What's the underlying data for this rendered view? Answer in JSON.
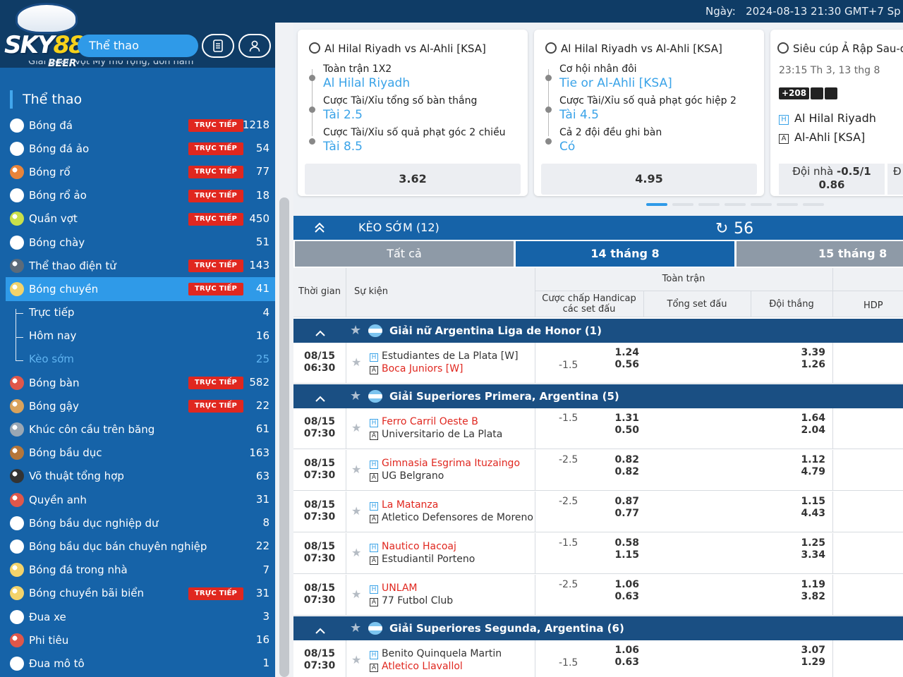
{
  "header": {
    "date_label": "Ngày:",
    "date_value": "2024-08-13 21:30 GMT+7 Sp",
    "brand_text": "SKY88",
    "brand_sub": "BEER",
    "sport_pill": "Thể thao",
    "peek_text": "Giải quần vợt Mỹ mở rộng, đơn nam"
  },
  "sidebar": {
    "section_title": "Thể thao",
    "live_label": "TRỰC TIẾP",
    "items": [
      {
        "label": "Bóng đá",
        "count": "1218",
        "live": true,
        "icon": "soccer-icon",
        "color": "#ffffff"
      },
      {
        "label": "Bóng đá ảo",
        "count": "54",
        "live": true,
        "icon": "virtual-soccer-icon",
        "color": "#ffffff"
      },
      {
        "label": "Bóng rổ",
        "count": "77",
        "live": true,
        "icon": "basketball-icon",
        "color": "#e8843a"
      },
      {
        "label": "Bóng rổ ảo",
        "count": "18",
        "live": true,
        "icon": "virtual-basketball-icon",
        "color": "#ffffff"
      },
      {
        "label": "Quần vợt",
        "count": "450",
        "live": true,
        "icon": "tennis-icon",
        "color": "#c9e04a"
      },
      {
        "label": "Bóng chày",
        "count": "51",
        "live": false,
        "icon": "baseball-icon",
        "color": "#ffffff"
      },
      {
        "label": "Thể thao điện tử",
        "count": "143",
        "live": true,
        "icon": "esports-icon",
        "color": "#5c6b7a"
      },
      {
        "label": "Bóng chuyền",
        "count": "41",
        "live": true,
        "icon": "volleyball-icon",
        "color": "#f3d36b",
        "active": true
      },
      {
        "label": "Trực tiếp",
        "count": "4",
        "live": false,
        "sub": true
      },
      {
        "label": "Hôm nay",
        "count": "16",
        "live": false,
        "sub": true
      },
      {
        "label": "Kèo sớm",
        "count": "25",
        "live": false,
        "sub": true,
        "muted": true
      },
      {
        "label": "Bóng bàn",
        "count": "582",
        "live": true,
        "icon": "table-tennis-icon",
        "color": "#e0574a"
      },
      {
        "label": "Bóng gậy",
        "count": "22",
        "live": true,
        "icon": "cricket-icon",
        "color": "#d9a25b"
      },
      {
        "label": "Khúc côn cầu trên băng",
        "count": "61",
        "live": false,
        "icon": "ice-hockey-icon",
        "color": "#9aa7b4"
      },
      {
        "label": "Bóng bầu dục",
        "count": "163",
        "live": false,
        "icon": "rugby-icon",
        "color": "#b5763a"
      },
      {
        "label": "Võ thuật tổng hợp",
        "count": "63",
        "live": false,
        "icon": "mma-icon",
        "color": "#333333"
      },
      {
        "label": "Quyền anh",
        "count": "31",
        "live": false,
        "icon": "boxing-icon",
        "color": "#e0574a"
      },
      {
        "label": "Bóng bầu dục nghiệp dư",
        "count": "8",
        "live": false,
        "icon": "rugby-union-icon",
        "color": "#ffffff"
      },
      {
        "label": "Bóng bầu dục bán chuyên nghiệp",
        "count": "22",
        "live": false,
        "icon": "rugby-league-icon",
        "color": "#ffffff"
      },
      {
        "label": "Bóng đá trong nhà",
        "count": "7",
        "live": false,
        "icon": "futsal-icon",
        "color": "#f3d36b"
      },
      {
        "label": "Bóng chuyền bãi biển",
        "count": "31",
        "live": true,
        "icon": "beach-volleyball-icon",
        "color": "#f3d36b"
      },
      {
        "label": "Đua xe",
        "count": "3",
        "live": false,
        "icon": "motorsport-icon",
        "color": "#ffffff"
      },
      {
        "label": "Phi tiêu",
        "count": "16",
        "live": false,
        "icon": "darts-icon",
        "color": "#e0574a"
      },
      {
        "label": "Đua mô tô",
        "count": "1",
        "live": false,
        "icon": "motorbike-icon",
        "color": "#ffffff"
      }
    ]
  },
  "cards": [
    {
      "title": "Al Hilal Riyadh vs Al-Ahli [KSA]",
      "lines": [
        {
          "market": "Toàn trận 1X2",
          "selection": "Al Hilal Riyadh"
        },
        {
          "market": "Cược Tài/Xỉu tổng số bàn thắng",
          "selection": "Tài 2.5"
        },
        {
          "market": "Cược Tài/Xỉu số quả phạt góc 2 chiều",
          "selection": "Tài 8.5"
        }
      ],
      "odds": "3.62"
    },
    {
      "title": "Al Hilal Riyadh vs Al-Ahli [KSA]",
      "lines": [
        {
          "market": "Cơ hội nhân đôi",
          "selection": "Tie or Al-Ahli [KSA]"
        },
        {
          "market": "Cược Tài/Xỉu số quả phạt góc hiệp 2",
          "selection": "Tài 4.5"
        },
        {
          "market": "Cả 2 đội đều ghi bàn",
          "selection": "Có"
        }
      ],
      "odds": "4.95"
    },
    {
      "title": "Siêu cúp Ả Rập Sau-đi",
      "time": "23:15 Th 3, 13 thg 8",
      "more": "+208",
      "home_tag": "H",
      "home": "Al Hilal Riyadh",
      "away_tag": "A",
      "away": "Al-Ahli [KSA]",
      "handicap_label": "Đội nhà",
      "handicap_line": "-0.5/1",
      "handicap_odds": "0.86",
      "next_label": "Đ"
    }
  ],
  "main": {
    "bar_title": "KÈO SỚM (12)",
    "refresh_count": "56",
    "tabs": [
      "Tất cả",
      "14 tháng 8",
      "15 tháng 8"
    ],
    "columns": {
      "time": "Thời gian",
      "event": "Sự kiện",
      "fulltime": "Toàn trận",
      "handicap": "Cược chấp Handicap các set đấu",
      "total": "Tổng set đấu",
      "winner": "Đội thắng",
      "hdp": "HDP"
    },
    "leagues": [
      {
        "name": "Giải nữ Argentina Liga de Honor (1)",
        "matches": [
          {
            "date": "08/15",
            "time": "06:30",
            "home": "Estudiantes de La Plata [W]",
            "away": "Boca Juniors [W]",
            "fav": "away",
            "hcap": "-1.5",
            "hcap_row": 2,
            "h1": "1.24",
            "h2": "0.56",
            "w1": "3.39",
            "w2": "1.26"
          }
        ]
      },
      {
        "name": "Giải Superiores Primera, Argentina (5)",
        "matches": [
          {
            "date": "08/15",
            "time": "07:30",
            "home": "Ferro Carril Oeste B",
            "away": "Universitario de La Plata",
            "fav": "home",
            "hcap": "-1.5",
            "hcap_row": 1,
            "h1": "1.31",
            "h2": "0.50",
            "w1": "1.64",
            "w2": "2.04"
          },
          {
            "date": "08/15",
            "time": "07:30",
            "home": "Gimnasia Esgrima Ituzaingo",
            "away": "UG Belgrano",
            "fav": "home",
            "hcap": "-2.5",
            "hcap_row": 1,
            "h1": "0.82",
            "h2": "0.82",
            "w1": "1.12",
            "w2": "4.79"
          },
          {
            "date": "08/15",
            "time": "07:30",
            "home": "La Matanza",
            "away": "Atletico Defensores de Moreno",
            "fav": "home",
            "hcap": "-2.5",
            "hcap_row": 1,
            "h1": "0.87",
            "h2": "0.77",
            "w1": "1.15",
            "w2": "4.43"
          },
          {
            "date": "08/15",
            "time": "07:30",
            "home": "Nautico Hacoaj",
            "away": "Estudiantil Porteno",
            "fav": "home",
            "hcap": "-1.5",
            "hcap_row": 1,
            "h1": "0.58",
            "h2": "1.15",
            "w1": "1.25",
            "w2": "3.34"
          },
          {
            "date": "08/15",
            "time": "07:30",
            "home": "UNLAM",
            "away": "77 Futbol Club",
            "fav": "home",
            "hcap": "-2.5",
            "hcap_row": 1,
            "h1": "1.06",
            "h2": "0.63",
            "w1": "1.19",
            "w2": "3.82"
          }
        ]
      },
      {
        "name": "Giải Superiores Segunda, Argentina (6)",
        "matches": [
          {
            "date": "08/15",
            "time": "07:30",
            "home": "Benito Quinquela Martin",
            "away": "Atletico Llavallol",
            "fav": "away",
            "hcap": "-1.5",
            "hcap_row": 2,
            "h1": "1.06",
            "h2": "0.63",
            "w1": "3.07",
            "w2": "1.29"
          }
        ]
      }
    ]
  }
}
